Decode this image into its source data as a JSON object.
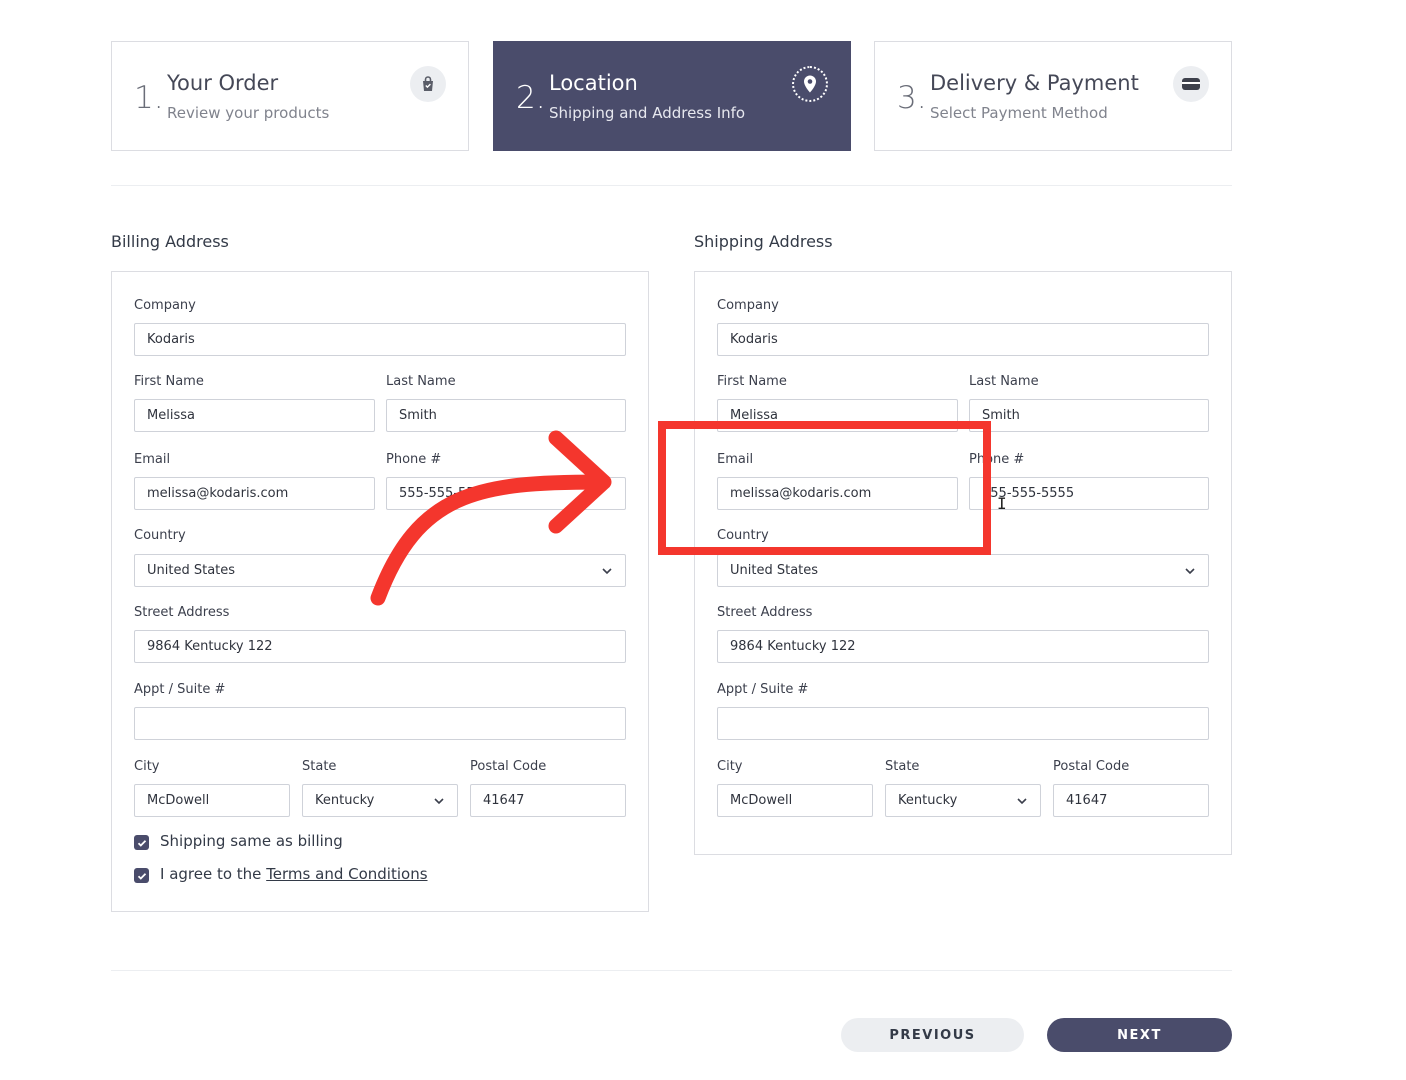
{
  "steps": [
    {
      "number": "1.",
      "title": "Your Order",
      "subtitle": "Review your products",
      "icon": "shopping-bag-icon"
    },
    {
      "number": "2.",
      "title": "Location",
      "subtitle": "Shipping and Address Info",
      "icon": "map-pin-icon"
    },
    {
      "number": "3.",
      "title": "Delivery & Payment",
      "subtitle": "Select Payment Method",
      "icon": "credit-card-icon"
    }
  ],
  "colors": {
    "accent": "#4a4c6b",
    "annotation": "#f4362d",
    "border": "#dcdde2"
  },
  "billing": {
    "title": "Billing Address",
    "company_label": "Company",
    "company": "Kodaris",
    "first_name_label": "First Name",
    "first_name": "Melissa",
    "last_name_label": "Last Name",
    "last_name": "Smith",
    "email_label": "Email",
    "email": "melissa@kodaris.com",
    "phone_label": "Phone #",
    "phone": "555-555-5555",
    "country_label": "Country",
    "country": "United States",
    "street_label": "Street Address",
    "street": "9864 Kentucky 122",
    "suite_label": "Appt / Suite #",
    "suite": "",
    "city_label": "City",
    "city": "McDowell",
    "state_label": "State",
    "state": "Kentucky",
    "postal_label": "Postal Code",
    "postal": "41647",
    "same_as_billing_label": "Shipping same as billing",
    "agree_prefix": "I agree to the ",
    "terms_link": "Terms and Conditions"
  },
  "shipping": {
    "title": "Shipping Address",
    "company_label": "Company",
    "company": "Kodaris",
    "first_name_label": "First Name",
    "first_name": "Melissa",
    "last_name_label": "Last Name",
    "last_name": "Smith",
    "email_label": "Email",
    "email": "melissa@kodaris.com",
    "phone_label": "Phone #",
    "phone": "555-555-5555",
    "country_label": "Country",
    "country": "United States",
    "street_label": "Street Address",
    "street": "9864 Kentucky 122",
    "suite_label": "Appt / Suite #",
    "suite": "",
    "city_label": "City",
    "city": "McDowell",
    "state_label": "State",
    "state": "Kentucky",
    "postal_label": "Postal Code",
    "postal": "41647"
  },
  "footer": {
    "previous_label": "PREVIOUS",
    "next_label": "NEXT"
  }
}
